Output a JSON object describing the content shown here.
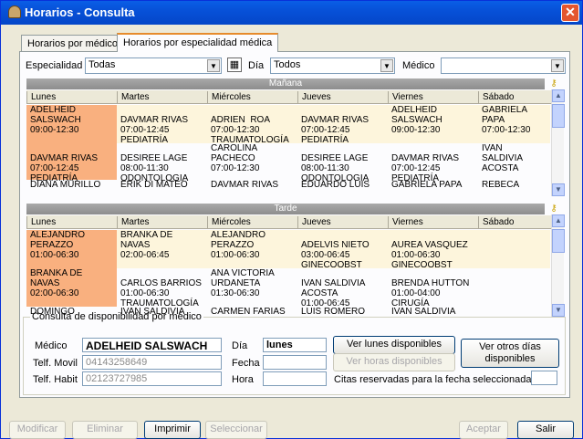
{
  "window": {
    "title": "Horarios - Consulta",
    "close_glyph": "✕"
  },
  "tabs": [
    {
      "label": "Horarios por médico"
    },
    {
      "label": "Horarios por especialidad médica"
    }
  ],
  "filters": {
    "especialidad_label": "Especialidad",
    "especialidad_value": "Todas",
    "dia_label": "Día",
    "dia_value": "Todos",
    "medico_label": "Médico",
    "medico_value": ""
  },
  "manana": {
    "band": "Mañana",
    "columns": [
      "Lunes",
      "Martes",
      "Miércoles",
      "Jueves",
      "Viernes",
      "Sábado"
    ],
    "rows": [
      [
        "ADELHEID\nSALSWACH\n09:00-12:30",
        "\nDAVMAR RIVAS\n07:00-12:45\nPEDIATRÍA",
        "\nADRIEN  ROA\n07:00-12:30\nTRAUMATOLOGÍA",
        "\nDAVMAR RIVAS\n07:00-12:45\nPEDIATRÍA",
        "ADELHEID\nSALSWACH\n09:00-12:30",
        "GABRIELA\nPAPA\n07:00-12:30"
      ],
      [
        "\nDAVMAR RIVAS\n07:00-12:45\nPEDIATRÍA",
        "\nDESIREE LAGE\n08:00-11:30\nODONTOLOGIA",
        "CAROLINA\nPACHECO\n07:00-12:30",
        "\nDESIREE LAGE\n08:00-11:30\nODONTOLOGIA",
        "\nDAVMAR RIVAS\n07:00-12:45\nPEDIATRÍA",
        "IVAN\nSALDIVIA\nACOSTA"
      ],
      [
        "DIANA MURILLO",
        "ERIK DI MATEO",
        "DAVMAR RIVAS",
        "EDUARDO LUIS",
        "GABRIELA PAPA",
        "REBECA"
      ]
    ]
  },
  "tarde": {
    "band": "Tarde",
    "columns": [
      "Lunes",
      "Martes",
      "Miércoles",
      "Jueves",
      "Viernes",
      "Sábado"
    ],
    "rows": [
      [
        "ALEJANDRO\nPERAZZO\n01:00-06:30",
        "BRANKA DE\nNAVAS\n02:00-06:45",
        "ALEJANDRO\nPERAZZO\n01:00-06:30",
        "\nADELVIS NIETO\n03:00-06:45\nGINECOOBST",
        "\nAUREA VASQUEZ\n01:00-06:30\nGINECOOBST",
        ""
      ],
      [
        "BRANKA DE\nNAVAS\n02:00-06:30",
        "\nCARLOS BARRIOS\n01:00-06:30\nTRAUMATOLOGÍA",
        "ANA VICTORIA\nURDANETA\n01:30-06:30",
        "\nIVAN SALDIVIA\nACOSTA\n01:00-06:45",
        "\nBRENDA HUTTON\n01:00-04:00\nCIRUGÍA",
        ""
      ],
      [
        "DOMINGO",
        "IVAN SALDIVIA",
        "CARMEN FARIAS",
        "LUIS ROMERO",
        "IVAN SALDIVIA",
        ""
      ]
    ]
  },
  "consulta": {
    "title": "Consulta de disponibilidad por médico",
    "medico_label": "Médico",
    "medico_value": "ADELHEID SALSWACH",
    "movil_label": "Telf. Movil",
    "movil_value": "04143258649",
    "habit_label": "Telf. Habit",
    "habit_value": "02123727985",
    "dia_label": "Día",
    "dia_value": "lunes",
    "fecha_label": "Fecha",
    "fecha_value": "",
    "hora_label": "Hora",
    "hora_value": "",
    "btn_ver_lunes": "Ver lunes disponibles",
    "btn_ver_horas": "Ver horas disponibles",
    "btn_ver_otros_1": "Ver otros días",
    "btn_ver_otros_2": "disponibles",
    "citas_label": "Citas reservadas para  la fecha seleccionada",
    "citas_value": ""
  },
  "bottom": {
    "modificar": "Modificar",
    "eliminar": "Eliminar",
    "imprimir": "Imprimir",
    "seleccionar": "Seleccionar",
    "aceptar": "Aceptar",
    "salir": "Salir"
  },
  "colors": {
    "selected_cell": "#f9b07f",
    "title_bar": "#0751d8",
    "highlight_row": "#fdf5dc"
  }
}
